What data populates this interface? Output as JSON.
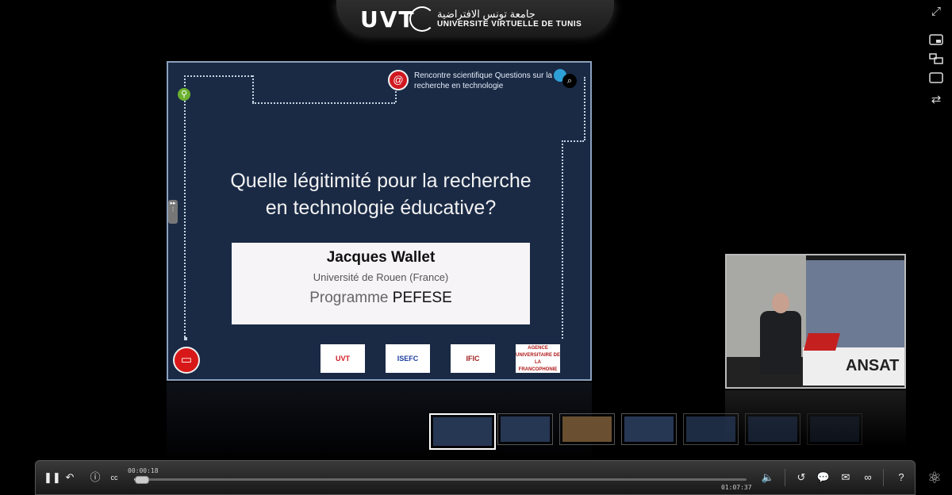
{
  "header": {
    "logo_text": "UVT",
    "logo_arabic": "جامعة تونس الافتراضية",
    "logo_subtitle": "UNIVERSITÉ VIRTUELLE DE TUNIS"
  },
  "side_controls": {
    "fullscreen_icon": "expand-arrows-icon",
    "layouts": [
      "pip-layout-icon",
      "swap-layout-icon",
      "single-layout-icon",
      "switch-icon"
    ]
  },
  "slide": {
    "header_text": "Rencontre scientifique Questions sur la recherche en technologie",
    "at_symbol": "@",
    "title_line1": "Quelle légitimité pour la recherche",
    "title_line2": "en technologie éducative?",
    "author": "Jacques Wallet",
    "affiliation": "Université de Rouen (France)",
    "program_label": "Programme",
    "program_name": "PEFESE",
    "logos": [
      "UVT",
      "ISEFC",
      "IFIC",
      "AGENCE UNIVERSITAIRE DE LA FRANCOPHONIE"
    ]
  },
  "video": {
    "sign_text": "ANSAT"
  },
  "thumbnails": {
    "count": 7,
    "active_index": 0
  },
  "player": {
    "current_time": "00:00:18",
    "total_time": "01:07:37",
    "progress": 0.004,
    "colors": {
      "bar": "#2a2a2a",
      "accent": "#dddddd"
    }
  }
}
